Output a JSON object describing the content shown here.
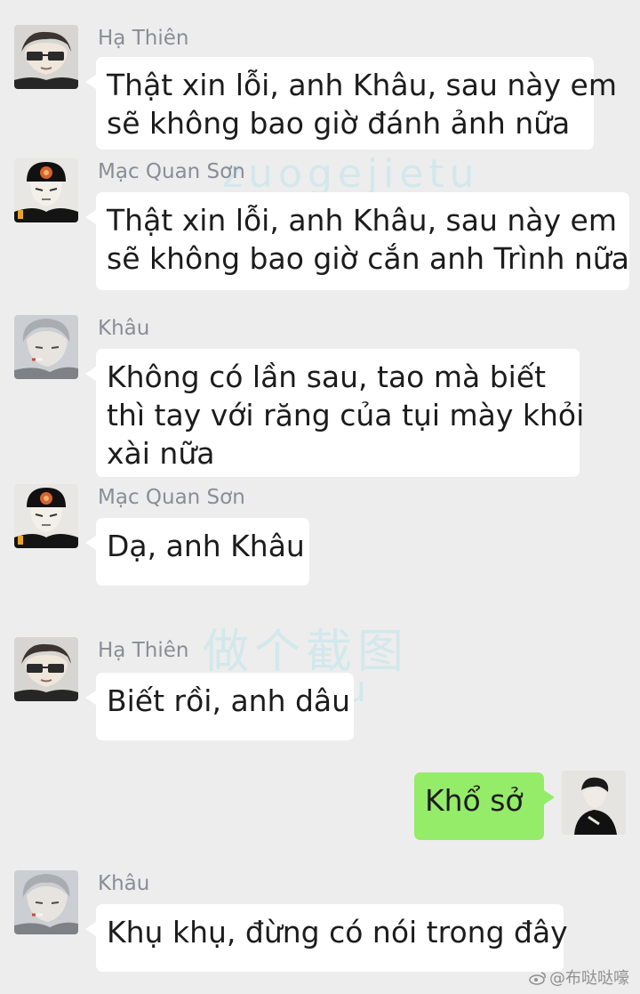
{
  "messages": [
    {
      "sender": "Hạ Thiên",
      "avatar": "ha-thien-avatar",
      "side": "left",
      "lines": [
        "Thật xin lỗi, anh Khâu, sau này em",
        "sẽ không bao giờ đánh ảnh nữa"
      ]
    },
    {
      "sender": "Mạc Quan Sơn",
      "avatar": "mac-quan-son-avatar",
      "side": "left",
      "lines": [
        "Thật xin lỗi, anh Khâu, sau này em",
        "sẽ không bao giờ cắn anh Trình nữa"
      ]
    },
    {
      "sender": "Khâu",
      "avatar": "khau-avatar",
      "side": "left",
      "lines": [
        "Không có lần sau, tao mà biết",
        "thì tay với răng của tụi mày khỏi",
        "xài nữa"
      ]
    },
    {
      "sender": "Mạc Quan Sơn",
      "avatar": "mac-quan-son-avatar",
      "side": "left",
      "lines": [
        "Dạ, anh Khâu"
      ]
    },
    {
      "sender": "Hạ Thiên",
      "avatar": "ha-thien-avatar",
      "side": "left",
      "lines": [
        "Biết rồi, anh dâu"
      ]
    },
    {
      "sender": "",
      "avatar": "self-avatar",
      "side": "right",
      "lines": [
        "Khổ sở"
      ]
    },
    {
      "sender": "Khâu",
      "avatar": "khau-avatar",
      "side": "left",
      "lines": [
        "Khụ khụ, đừng có nói trong đây"
      ]
    }
  ],
  "watermark": {
    "text_cn": "做个截图",
    "text_1": "zuogejietu",
    "text_2": "zuogejietu",
    "text_3": "jietu"
  },
  "credit": "@布哒哒嚎",
  "colors": {
    "background": "#ededed",
    "bubble_other": "#ffffff",
    "bubble_self": "#95ec69",
    "sender_name": "#8a8d96"
  }
}
